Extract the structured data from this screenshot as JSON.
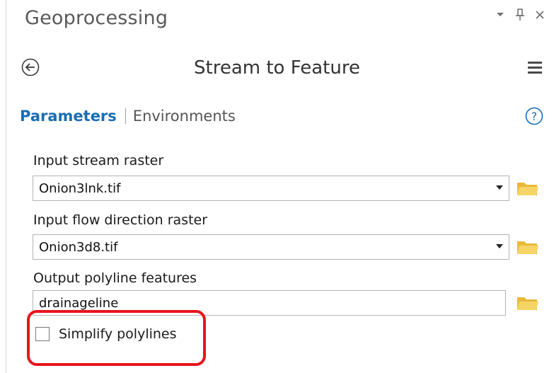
{
  "pane": {
    "title": "Geoprocessing",
    "controls": {
      "dropdown_icon": "chevron-down-icon",
      "pin_icon": "pin-icon",
      "close_icon": "close-icon"
    }
  },
  "tool": {
    "title": "Stream to Feature",
    "back_icon": "back-arrow-icon",
    "menu_icon": "hamburger-menu-icon"
  },
  "tabs": {
    "parameters": "Parameters",
    "environments": "Environments",
    "help_icon": "help-icon"
  },
  "params": {
    "input_stream": {
      "label": "Input stream raster",
      "value": "Onion3lnk.tif"
    },
    "input_flow": {
      "label": "Input flow direction raster",
      "value": "Onion3d8.tif"
    },
    "output": {
      "label": "Output polyline features",
      "value": "drainageline"
    },
    "simplify": {
      "label": "Simplify polylines",
      "checked": false
    }
  },
  "colors": {
    "accent": "#1a6db3",
    "highlight": "#e8141c",
    "folder": "#f0c94a"
  }
}
